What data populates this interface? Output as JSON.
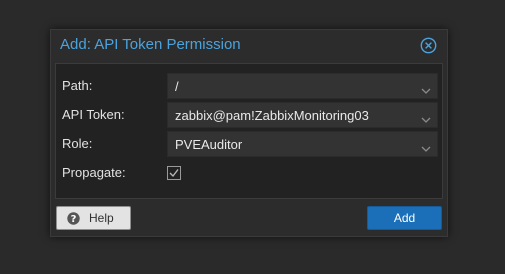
{
  "dialog": {
    "title": "Add: API Token Permission",
    "close_icon": "close-circle-icon"
  },
  "form": {
    "path": {
      "label": "Path:",
      "value": "/"
    },
    "api_token": {
      "label": "API Token:",
      "value": "zabbix@pam!ZabbixMonitoring03"
    },
    "role": {
      "label": "Role:",
      "value": "PVEAuditor"
    },
    "propagate": {
      "label": "Propagate:",
      "checked": true
    }
  },
  "footer": {
    "help_label": "Help",
    "help_icon": "question-circle-icon",
    "add_label": "Add"
  },
  "colors": {
    "accent": "#4ba3dd",
    "primary_button": "#1a6fb8",
    "background": "#2c2c2c"
  }
}
